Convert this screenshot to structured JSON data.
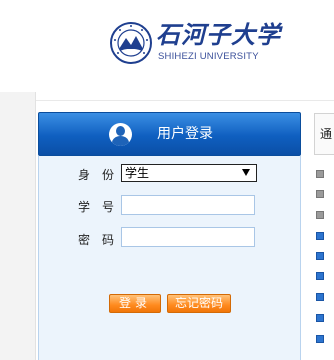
{
  "header": {
    "logo_name_cn": "石河子大学",
    "logo_name_en": "SHIHEZI UNIVERSITY",
    "seal_ring_text": "石河子大学"
  },
  "login_panel": {
    "title": "用户登录",
    "identity_label": "身份",
    "identity_selected": "学生",
    "student_id_label": "学号",
    "student_id_value": "",
    "password_label": "密码",
    "password_value": "",
    "login_button": "登录",
    "forgot_button": "忘记密码"
  },
  "right_panel": {
    "tab_label": "通"
  },
  "colors": {
    "panel_header": "#0f5fc0",
    "panel_body": "#ecf4fc",
    "button_orange": "#ff8a1e",
    "logo_blue": "#1f3f8f"
  }
}
